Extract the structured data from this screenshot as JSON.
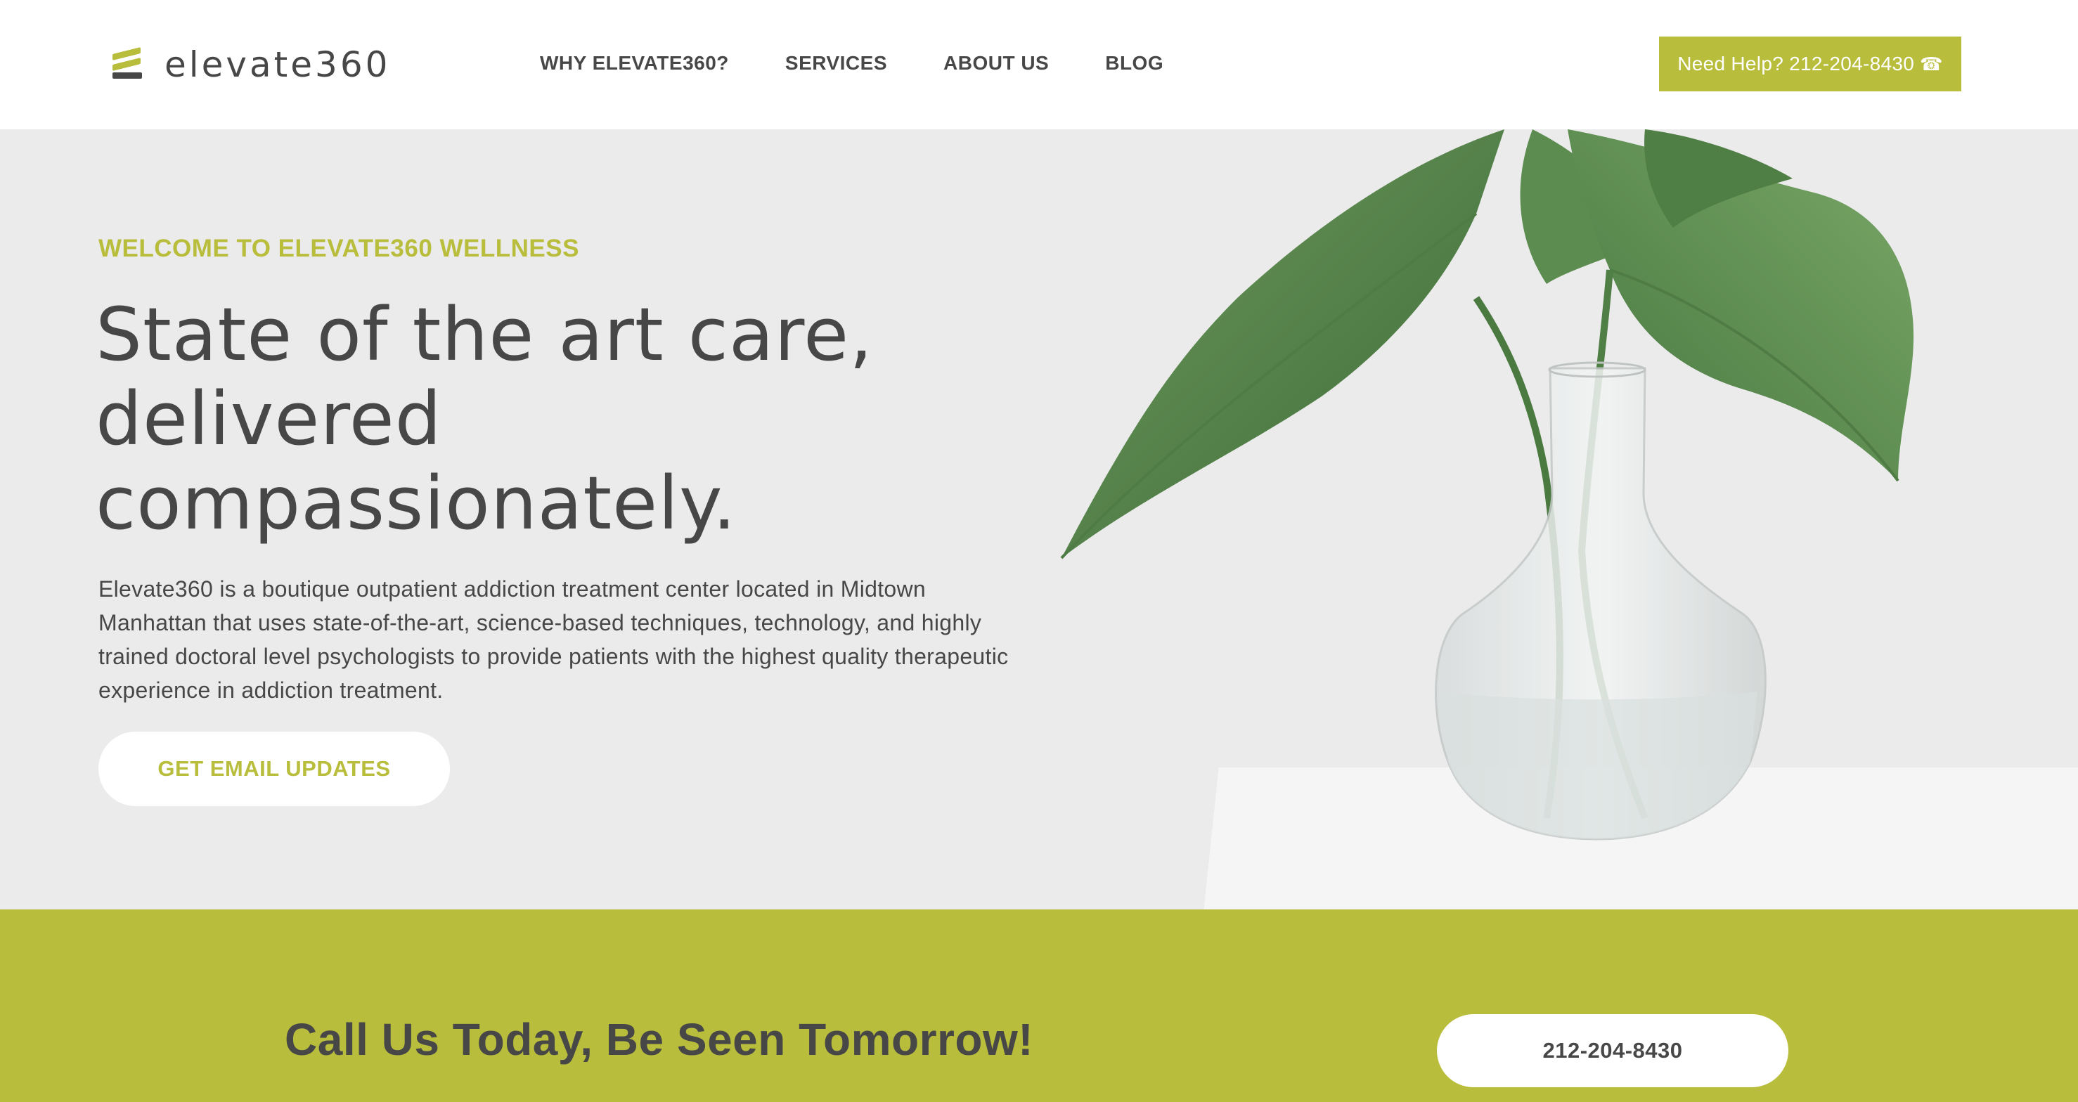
{
  "brand": {
    "name": "elevate360",
    "accent_color": "#b9bd3c",
    "text_color": "#474747"
  },
  "nav": {
    "items": [
      {
        "label": "WHY ELEVATE360?"
      },
      {
        "label": "SERVICES"
      },
      {
        "label": "ABOUT US"
      },
      {
        "label": "BLOG"
      }
    ]
  },
  "header": {
    "help_label": "Need Help? 212-204-8430",
    "help_icon": "☎"
  },
  "hero": {
    "eyebrow": "WELCOME TO ELEVATE360 WELLNESS",
    "headline_lines": [
      "State of the art care,",
      "delivered",
      "compassionately."
    ],
    "intro": "Elevate360 is a boutique outpatient addiction treatment center located in Midtown Manhattan that uses state-of-the-art, science-based techniques, technology, and highly trained doctoral level psychologists to provide patients with the highest quality therapeutic experience in addiction treatment.",
    "cta_label": "GET EMAIL UPDATES",
    "image_icon": "plant-vase-image"
  },
  "cta_band": {
    "title": "Call Us Today, Be Seen Tomorrow!",
    "phone_label": "212-204-8430"
  }
}
